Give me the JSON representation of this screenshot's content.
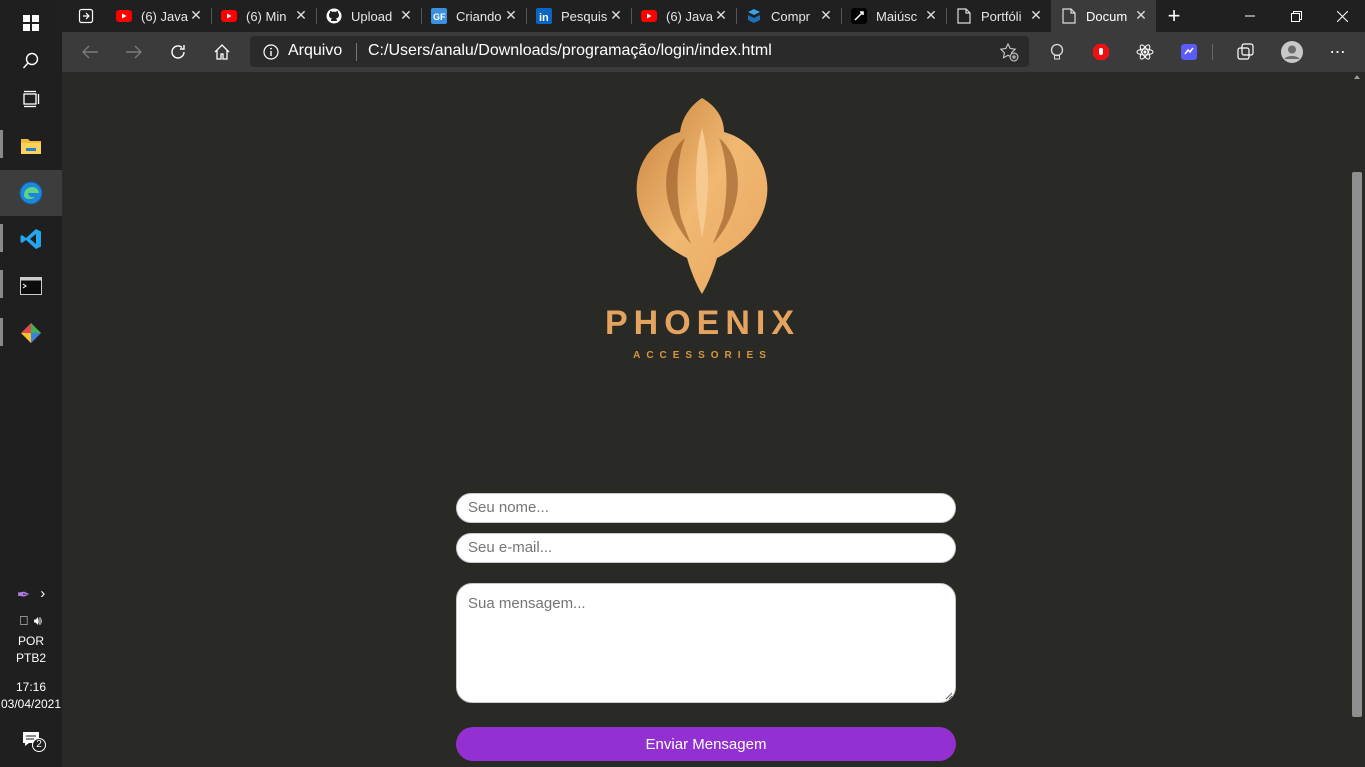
{
  "taskbar": {
    "apps": [
      "windows-start",
      "search",
      "task-view",
      "file-explorer",
      "edge",
      "vscode",
      "terminal",
      "git-kraken"
    ],
    "tray": {
      "language_1": "POR",
      "language_2": "PTB2",
      "time": "17:16",
      "date": "03/04/2021",
      "notification_count": "2"
    }
  },
  "browser": {
    "tabs": [
      {
        "icon": "youtube-icon",
        "label": "(6) Java"
      },
      {
        "icon": "youtube-icon",
        "label": "(6) Min"
      },
      {
        "icon": "github-icon",
        "label": "Upload"
      },
      {
        "icon": "gf-icon",
        "label": "Criando"
      },
      {
        "icon": "linkedin-icon",
        "label": "Pesquis"
      },
      {
        "icon": "youtube-icon",
        "label": "(6) Java"
      },
      {
        "icon": "compr-icon",
        "label": "Compr"
      },
      {
        "icon": "maiusc-icon",
        "label": "Maiúsc"
      },
      {
        "icon": "document-icon",
        "label": "Portfóli"
      },
      {
        "icon": "document-icon",
        "label": "Docum"
      }
    ],
    "address": {
      "scheme_label": "Arquivo",
      "url": "C:/Users/analu/Downloads/programação/login/index.html"
    }
  },
  "page": {
    "logo_text": "PHOENIX",
    "logo_subtext": "ACCESSORIES",
    "name_placeholder": "Seu nome...",
    "email_placeholder": "Seu e-mail...",
    "message_placeholder": "Sua mensagem...",
    "submit_label": "Enviar Mensagem"
  },
  "colors": {
    "page_bg": "#292925",
    "accent": "#9330d2",
    "logo": "#e4a35e"
  }
}
